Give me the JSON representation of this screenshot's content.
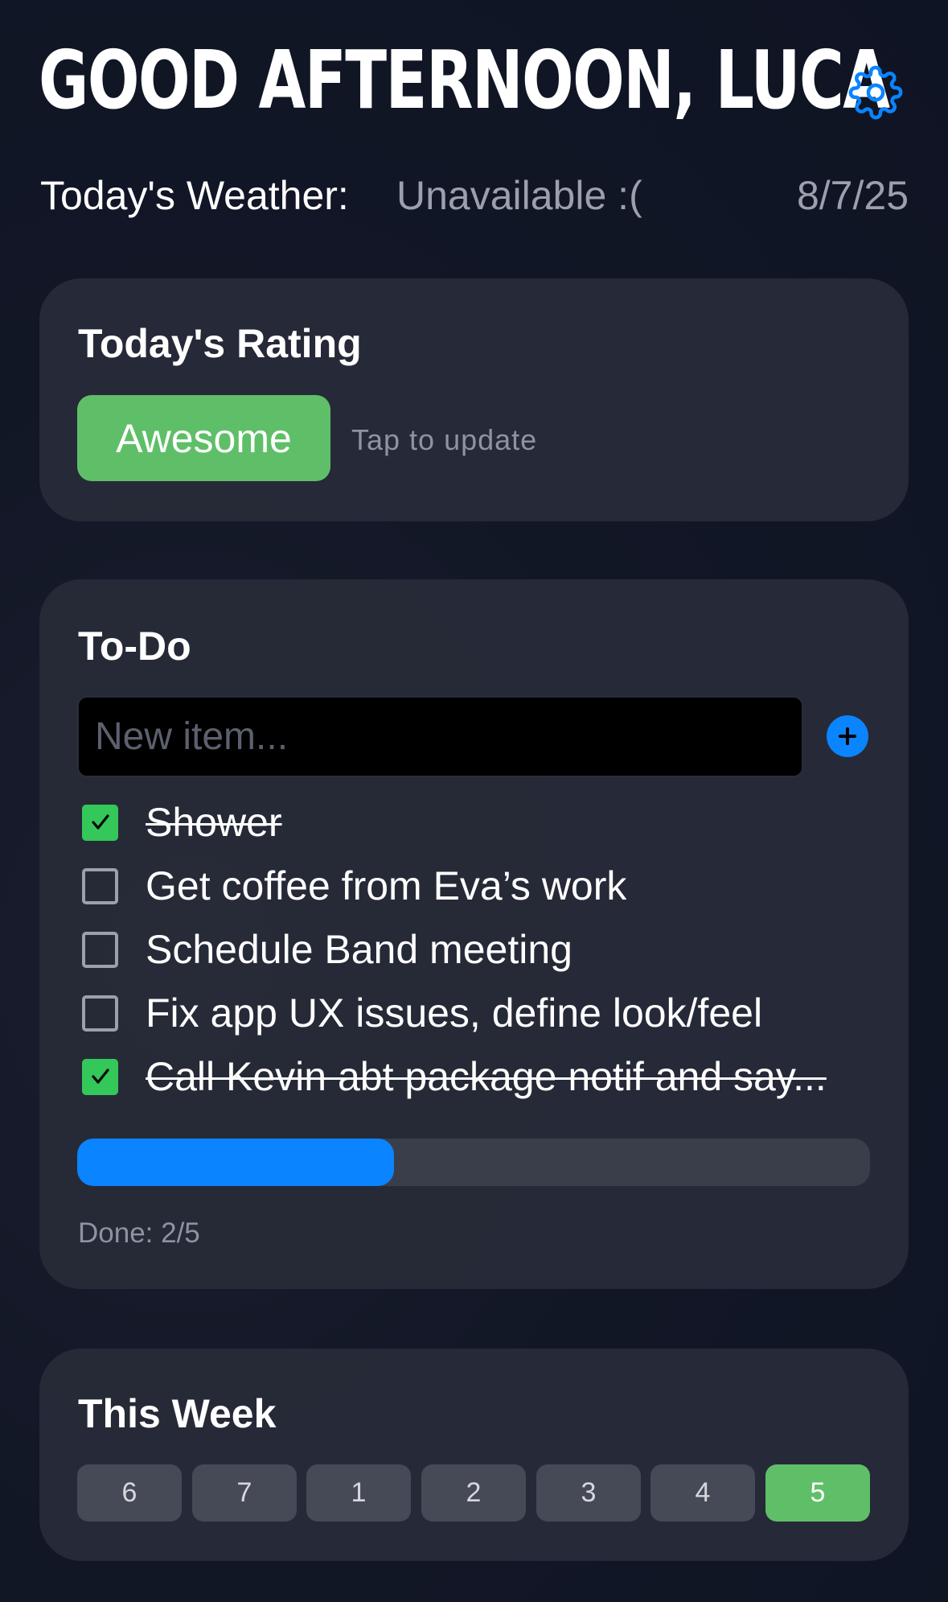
{
  "header": {
    "greeting": "GOOD AFTERNOON, LUCA",
    "settings_icon": "gear-icon"
  },
  "weather": {
    "label": "Today's Weather:",
    "value": "Unavailable :(",
    "date": "8/7/25"
  },
  "rating": {
    "title": "Today's Rating",
    "value": "Awesome",
    "hint": "Tap to update",
    "color": "#5fbf68"
  },
  "todo": {
    "title": "To-Do",
    "input_placeholder": "New item...",
    "input_value": "",
    "add_icon": "plus-circle-icon",
    "items": [
      {
        "label": "Shower",
        "done": true
      },
      {
        "label": "Get coffee from Eva’s work",
        "done": false
      },
      {
        "label": "Schedule Band meeting",
        "done": false
      },
      {
        "label": "Fix app UX issues, define look/feel",
        "done": false
      },
      {
        "label": "Call Kevin abt package notif and say...",
        "done": true
      }
    ],
    "progress": 0.4,
    "done_text": "Done: 2/5",
    "accent": "#0a84ff",
    "check_color": "#34c759"
  },
  "week": {
    "title": "This Week",
    "days": [
      {
        "label": "6",
        "today": false
      },
      {
        "label": "7",
        "today": false
      },
      {
        "label": "1",
        "today": false
      },
      {
        "label": "2",
        "today": false
      },
      {
        "label": "3",
        "today": false
      },
      {
        "label": "4",
        "today": false
      },
      {
        "label": "5",
        "today": true
      }
    ]
  }
}
